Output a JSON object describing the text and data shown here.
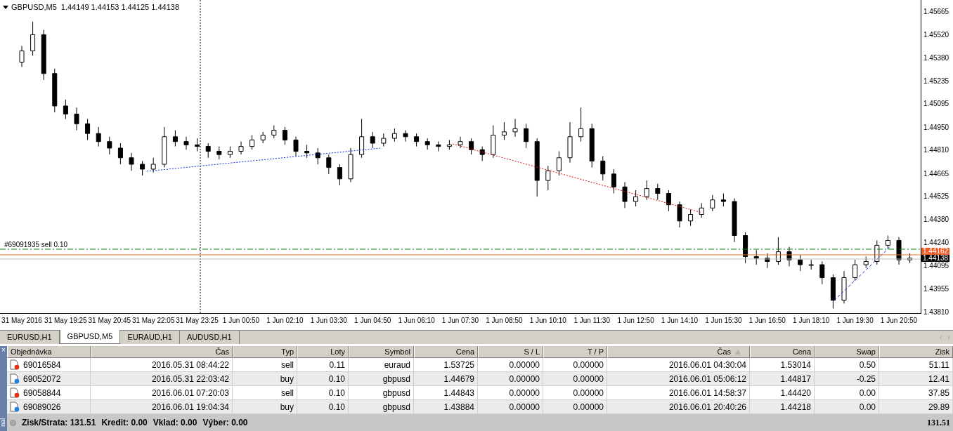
{
  "chart": {
    "header": {
      "title": "GBPUSD,M5",
      "ohlc": "1.44149 1.44153 1.44125 1.44138"
    },
    "chart_data": {
      "type": "candlestick",
      "ylim": [
        1.43797,
        1.45734
      ],
      "yticks": [
        {
          "value": 1.45665,
          "label": "1.45665"
        },
        {
          "value": 1.4552,
          "label": "1.45520"
        },
        {
          "value": 1.4538,
          "label": "1.45380"
        },
        {
          "value": 1.45235,
          "label": "1.45235"
        },
        {
          "value": 1.45095,
          "label": "1.45095"
        },
        {
          "value": 1.4495,
          "label": "1.44950"
        },
        {
          "value": 1.4481,
          "label": "1.44810"
        },
        {
          "value": 1.44665,
          "label": "1.44665"
        },
        {
          "value": 1.44525,
          "label": "1.44525"
        },
        {
          "value": 1.4438,
          "label": "1.44380"
        },
        {
          "value": 1.4424,
          "label": "1.44240"
        },
        {
          "value": 1.44095,
          "label": "1.44095"
        },
        {
          "value": 1.43955,
          "label": "1.43955"
        },
        {
          "value": 1.4381,
          "label": "1.43810"
        }
      ],
      "categories": [
        "31 May 2016",
        null,
        null,
        null,
        "31 May 19:25",
        null,
        null,
        null,
        "31 May 20:45",
        null,
        null,
        null,
        "31 May 22:05",
        null,
        null,
        null,
        "31 May 23:25",
        null,
        null,
        null,
        "1 Jun 00:50",
        null,
        null,
        null,
        "1 Jun 02:10",
        null,
        null,
        null,
        "1 Jun 03:30",
        null,
        null,
        null,
        "1 Jun 04:50",
        null,
        null,
        null,
        "1 Jun 06:10",
        null,
        null,
        null,
        "1 Jun 07:30",
        null,
        null,
        null,
        "1 Jun 08:50",
        null,
        null,
        null,
        "1 Jun 10:10",
        null,
        null,
        null,
        "1 Jun 11:30",
        null,
        null,
        null,
        "1 Jun 12:50",
        null,
        null,
        null,
        "1 Jun 14:10",
        null,
        null,
        null,
        "1 Jun 15:30",
        null,
        null,
        null,
        "1 Jun 16:50",
        null,
        null,
        null,
        "1 Jun 18:10",
        null,
        null,
        null,
        "1 Jun 19:30",
        null,
        null,
        null,
        "1 Jun 20:50",
        null
      ],
      "ohlc": [
        [
          1.4535,
          1.4545,
          1.4532,
          1.4542
        ],
        [
          1.4542,
          1.456,
          1.4539,
          1.4552
        ],
        [
          1.4552,
          1.4555,
          1.4524,
          1.4528
        ],
        [
          1.4528,
          1.4531,
          1.4504,
          1.4508
        ],
        [
          1.4508,
          1.4512,
          1.45,
          1.4503
        ],
        [
          1.4503,
          1.4507,
          1.4493,
          1.4497
        ],
        [
          1.4497,
          1.45,
          1.4487,
          1.4491
        ],
        [
          1.4491,
          1.4495,
          1.4483,
          1.4486
        ],
        [
          1.4486,
          1.4489,
          1.4478,
          1.4482
        ],
        [
          1.4482,
          1.4485,
          1.4472,
          1.4476
        ],
        [
          1.4476,
          1.4479,
          1.4468,
          1.4472
        ],
        [
          1.4472,
          1.4474,
          1.4465,
          1.4469
        ],
        [
          1.4469,
          1.4476,
          1.4467,
          1.4472
        ],
        [
          1.4472,
          1.4495,
          1.447,
          1.4489
        ],
        [
          1.4489,
          1.4493,
          1.4483,
          1.4486
        ],
        [
          1.4486,
          1.4489,
          1.4481,
          1.4484
        ],
        [
          1.4484,
          1.4488,
          1.448,
          1.4483
        ],
        [
          1.4483,
          1.4485,
          1.4476,
          1.448
        ],
        [
          1.448,
          1.4483,
          1.4475,
          1.4478
        ],
        [
          1.4478,
          1.4483,
          1.4476,
          1.448
        ],
        [
          1.448,
          1.4486,
          1.4478,
          1.4483
        ],
        [
          1.4483,
          1.449,
          1.4481,
          1.4487
        ],
        [
          1.4487,
          1.4492,
          1.4485,
          1.449
        ],
        [
          1.449,
          1.4496,
          1.4488,
          1.4493
        ],
        [
          1.4493,
          1.4495,
          1.4484,
          1.4487
        ],
        [
          1.4487,
          1.4489,
          1.4477,
          1.448
        ],
        [
          1.448,
          1.4484,
          1.4476,
          1.4479
        ],
        [
          1.4479,
          1.4482,
          1.4472,
          1.4476
        ],
        [
          1.4476,
          1.4478,
          1.4466,
          1.447
        ],
        [
          1.447,
          1.4472,
          1.4459,
          1.4463
        ],
        [
          1.4463,
          1.4482,
          1.4461,
          1.4478
        ],
        [
          1.4478,
          1.45,
          1.4476,
          1.4489
        ],
        [
          1.4489,
          1.4492,
          1.4482,
          1.4485
        ],
        [
          1.4485,
          1.4491,
          1.4483,
          1.4488
        ],
        [
          1.4488,
          1.4494,
          1.4486,
          1.4491
        ],
        [
          1.4491,
          1.4493,
          1.4486,
          1.4489
        ],
        [
          1.4489,
          1.4491,
          1.4483,
          1.4486
        ],
        [
          1.4486,
          1.4488,
          1.4481,
          1.4484
        ],
        [
          1.4484,
          1.4486,
          1.448,
          1.4483
        ],
        [
          1.4483,
          1.4487,
          1.4481,
          1.4484
        ],
        [
          1.4484,
          1.4489,
          1.4482,
          1.4486
        ],
        [
          1.4486,
          1.4488,
          1.4478,
          1.4481
        ],
        [
          1.4481,
          1.4483,
          1.4474,
          1.4478
        ],
        [
          1.4478,
          1.4496,
          1.4476,
          1.449
        ],
        [
          1.449,
          1.4498,
          1.4487,
          1.4492
        ],
        [
          1.4492,
          1.45,
          1.4489,
          1.4494
        ],
        [
          1.4494,
          1.4497,
          1.4482,
          1.4486
        ],
        [
          1.4486,
          1.4488,
          1.4452,
          1.4462
        ],
        [
          1.4462,
          1.4471,
          1.4456,
          1.4468
        ],
        [
          1.4468,
          1.448,
          1.4465,
          1.4476
        ],
        [
          1.4476,
          1.4498,
          1.4473,
          1.4489
        ],
        [
          1.4489,
          1.4507,
          1.4486,
          1.4494
        ],
        [
          1.4494,
          1.4497,
          1.447,
          1.4474
        ],
        [
          1.4474,
          1.4477,
          1.4462,
          1.4466
        ],
        [
          1.4466,
          1.4469,
          1.4454,
          1.4458
        ],
        [
          1.4458,
          1.4461,
          1.4445,
          1.4449
        ],
        [
          1.4449,
          1.4456,
          1.4446,
          1.4452
        ],
        [
          1.4452,
          1.4462,
          1.445,
          1.4457
        ],
        [
          1.4457,
          1.446,
          1.445,
          1.4454
        ],
        [
          1.4454,
          1.4456,
          1.4443,
          1.4447
        ],
        [
          1.4447,
          1.4449,
          1.4433,
          1.4437
        ],
        [
          1.4437,
          1.4444,
          1.4434,
          1.4441
        ],
        [
          1.4441,
          1.4448,
          1.4439,
          1.4445
        ],
        [
          1.4445,
          1.4453,
          1.4443,
          1.445
        ],
        [
          1.445,
          1.4454,
          1.4446,
          1.4449
        ],
        [
          1.4449,
          1.4451,
          1.4424,
          1.4428
        ],
        [
          1.4428,
          1.443,
          1.4411,
          1.4415
        ],
        [
          1.4415,
          1.4419,
          1.441,
          1.4414
        ],
        [
          1.4414,
          1.4417,
          1.4408,
          1.4412
        ],
        [
          1.4412,
          1.4427,
          1.441,
          1.4418
        ],
        [
          1.4418,
          1.4421,
          1.4409,
          1.4413
        ],
        [
          1.4413,
          1.4416,
          1.4406,
          1.441
        ],
        [
          1.441,
          1.4413,
          1.4407,
          1.441
        ],
        [
          1.441,
          1.4412,
          1.4398,
          1.4402
        ],
        [
          1.4402,
          1.4404,
          1.4383,
          1.4388
        ],
        [
          1.4388,
          1.4406,
          1.4386,
          1.4402
        ],
        [
          1.4402,
          1.4413,
          1.44,
          1.441
        ],
        [
          1.441,
          1.4415,
          1.4408,
          1.4412
        ],
        [
          1.4412,
          1.4425,
          1.441,
          1.4422
        ],
        [
          1.4422,
          1.4428,
          1.442,
          1.4425
        ],
        [
          1.4425,
          1.4427,
          1.441,
          1.4413
        ],
        [
          1.4413,
          1.4417,
          1.4411,
          1.4414
        ]
      ]
    },
    "order_label": "#69091935 sell 0.10",
    "price_badges": [
      {
        "text": "1.44162",
        "color": "#f05a28"
      },
      {
        "text": "1.44138",
        "color": "#000000"
      }
    ]
  },
  "tabs": [
    {
      "label": "EURUSD,H1",
      "selected": false
    },
    {
      "label": "GBPUSD,M5",
      "selected": true
    },
    {
      "label": "EURAUD,H1",
      "selected": false
    },
    {
      "label": "AUDUSD,H1",
      "selected": false
    }
  ],
  "side_label": "nal",
  "close_glyph": "×",
  "scroll_glyphs": [
    "‹",
    "›"
  ],
  "table": {
    "columns": [
      {
        "label": "Objednávka",
        "sorted": false
      },
      {
        "label": "Čas",
        "sorted": false
      },
      {
        "label": "Typ",
        "sorted": false
      },
      {
        "label": "Loty",
        "sorted": false
      },
      {
        "label": "Symbol",
        "sorted": false
      },
      {
        "label": "Cena",
        "sorted": false
      },
      {
        "label": "S / L",
        "sorted": false
      },
      {
        "label": "T / P",
        "sorted": false
      },
      {
        "label": "Čas",
        "sorted": true
      },
      {
        "label": "Cena",
        "sorted": false
      },
      {
        "label": "Swap",
        "sorted": false
      },
      {
        "label": "Zisk",
        "sorted": false
      }
    ],
    "rows": [
      {
        "kind": "sell",
        "cells": [
          "69016584",
          "2016.05.31 08:44:22",
          "sell",
          "0.11",
          "euraud",
          "1.53725",
          "0.00000",
          "0.00000",
          "2016.06.01 04:30:04",
          "1.53014",
          "0.50",
          "51.11"
        ]
      },
      {
        "kind": "buy",
        "cells": [
          "69052072",
          "2016.05.31 22:03:42",
          "buy",
          "0.10",
          "gbpusd",
          "1.44679",
          "0.00000",
          "0.00000",
          "2016.06.01 05:06:12",
          "1.44817",
          "-0.25",
          "12.41"
        ]
      },
      {
        "kind": "sell",
        "cells": [
          "69058844",
          "2016.06.01 07:20:03",
          "sell",
          "0.10",
          "gbpusd",
          "1.44843",
          "0.00000",
          "0.00000",
          "2016.06.01 14:58:37",
          "1.44420",
          "0.00",
          "37.85"
        ]
      },
      {
        "kind": "buy",
        "cells": [
          "69089026",
          "2016.06.01 19:04:34",
          "buy",
          "0.10",
          "gbpusd",
          "1.43884",
          "0.00000",
          "0.00000",
          "2016.06.01 20:40:26",
          "1.44218",
          "0.00",
          "29.89"
        ]
      }
    ]
  },
  "summary": {
    "items": [
      "Zisk/Strata: 131.51",
      "Kredit: 0.00",
      "Vklad: 0.00",
      "Výber: 0.00"
    ],
    "total": "131.51"
  }
}
